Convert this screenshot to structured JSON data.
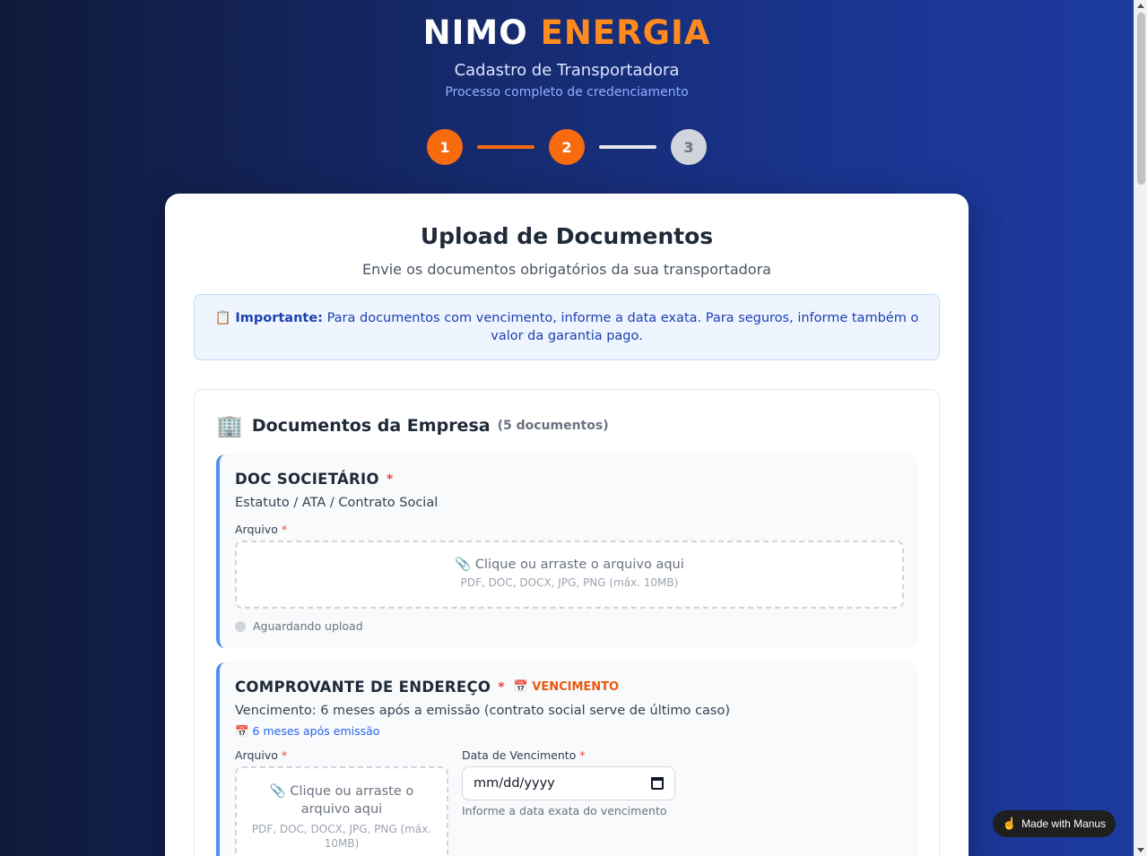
{
  "header": {
    "logo_white": "NIMO",
    "logo_orange": "ENERGIA",
    "subtitle": "Cadastro de Transportadora",
    "tagline": "Processo completo de credenciamento"
  },
  "steps": [
    {
      "label": "1",
      "state": "active"
    },
    {
      "label": "2",
      "state": "active"
    },
    {
      "label": "3",
      "state": "pending"
    }
  ],
  "card": {
    "title": "Upload de Documentos",
    "lead": "Envie os documentos obrigatórios da sua transportadora",
    "notice_icon": "📋",
    "notice_bold": "Importante:",
    "notice_text": "Para documentos com vencimento, informe a data exata. Para seguros, informe também o valor da garantia pago."
  },
  "section": {
    "icon": "🏢",
    "title": "Documentos da Empresa",
    "count": "(5 documentos)"
  },
  "docs": [
    {
      "name": "DOC SOCIETÁRIO",
      "required_mark": "*",
      "description": "Estatuto / ATA / Contrato Social",
      "file_label": "Arquivo",
      "dropzone_text": "📎 Clique ou arraste o arquivo aqui",
      "dropzone_formats": "PDF, DOC, DOCX, JPG, PNG (máx. 10MB)",
      "status": "Aguardando upload"
    },
    {
      "name": "COMPROVANTE DE ENDEREÇO",
      "required_mark": "*",
      "badge": "📅 VENCIMENTO",
      "description": "Vencimento: 6 meses após a emissão (contrato social serve de último caso)",
      "expiry_hint": "📅 6 meses após emissão",
      "file_label": "Arquivo",
      "dropzone_text": "📎 Clique ou arraste o arquivo aqui",
      "dropzone_formats": "PDF, DOC, DOCX, JPG, PNG (máx. 10MB)",
      "date_label": "Data de Vencimento",
      "date_placeholder": "mm/dd/yyyy",
      "date_hint": "Informe a data exata do vencimento"
    }
  ],
  "footer_badge": {
    "icon": "hand-icon",
    "text": "Made with Manus"
  },
  "colors": {
    "accent": "#f76b0f",
    "brand_orange": "#ff8a1f",
    "doc_border": "#4e8ff0",
    "required": "#ef4444"
  }
}
